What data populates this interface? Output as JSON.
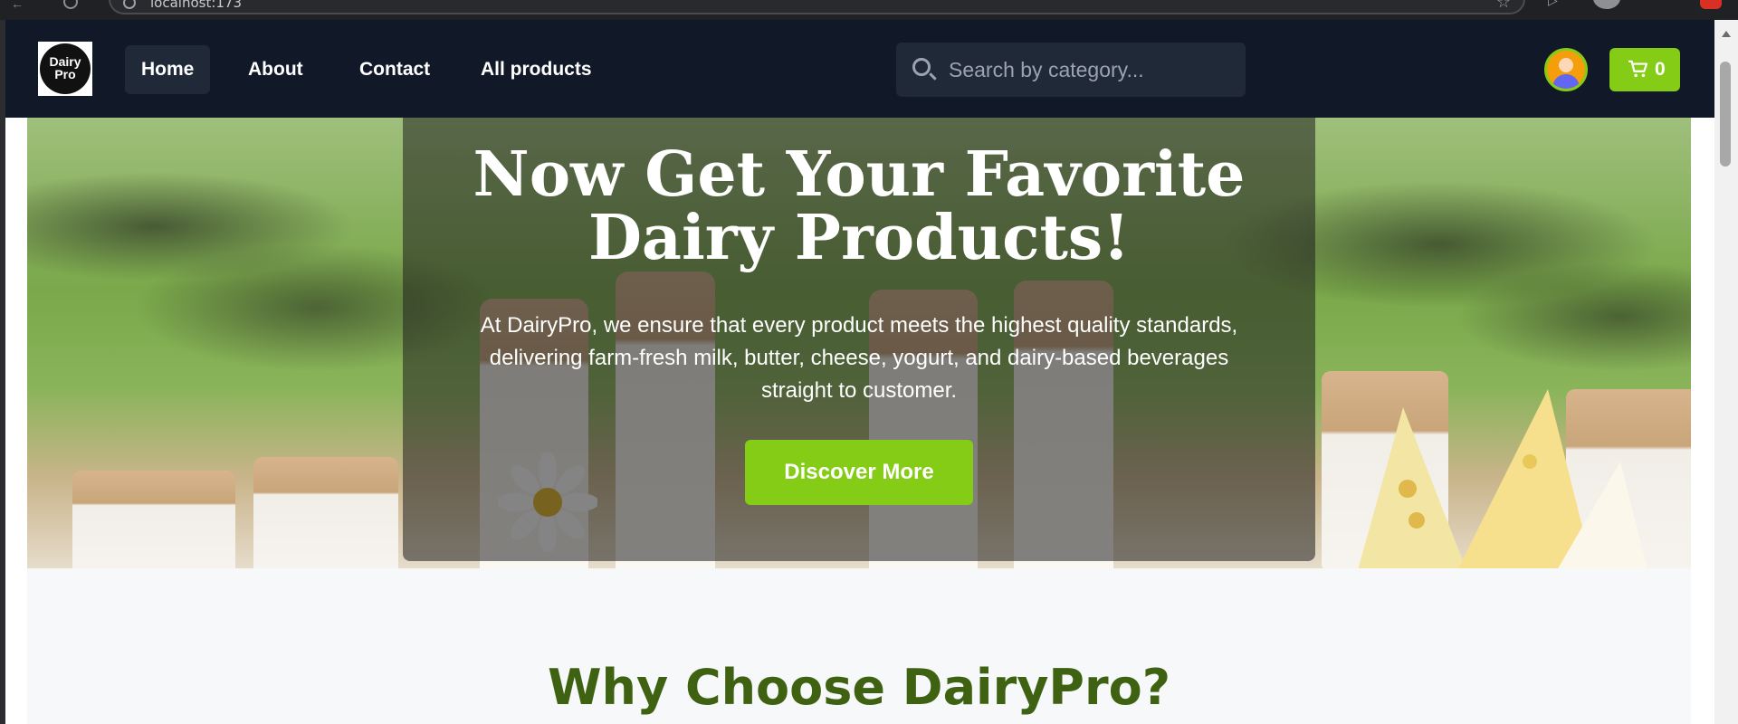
{
  "browser": {
    "url": "localhost:173",
    "icons": [
      "back-icon",
      "reload-icon",
      "info-icon",
      "star-icon",
      "extension-icon",
      "profile-icon"
    ]
  },
  "brand": {
    "logo_text": "Dairy Pro"
  },
  "nav": {
    "links": [
      "Home",
      "About",
      "Contact",
      "All products"
    ],
    "active": "Home"
  },
  "search": {
    "placeholder": "Search by category..."
  },
  "cart": {
    "count": "0"
  },
  "hero": {
    "title": "Now Get Your Favorite Dairy Products!",
    "description": "At DairyPro, we ensure that every product meets the highest quality standards, delivering farm-fresh milk, butter, cheese, yogurt, and dairy-based beverages straight to customer.",
    "cta_label": "Discover More"
  },
  "why_section": {
    "heading": "Why Choose DairyPro?"
  },
  "colors": {
    "nav_bg": "#111827",
    "accent_green": "#84cc16",
    "heading_green": "#3f6212"
  }
}
